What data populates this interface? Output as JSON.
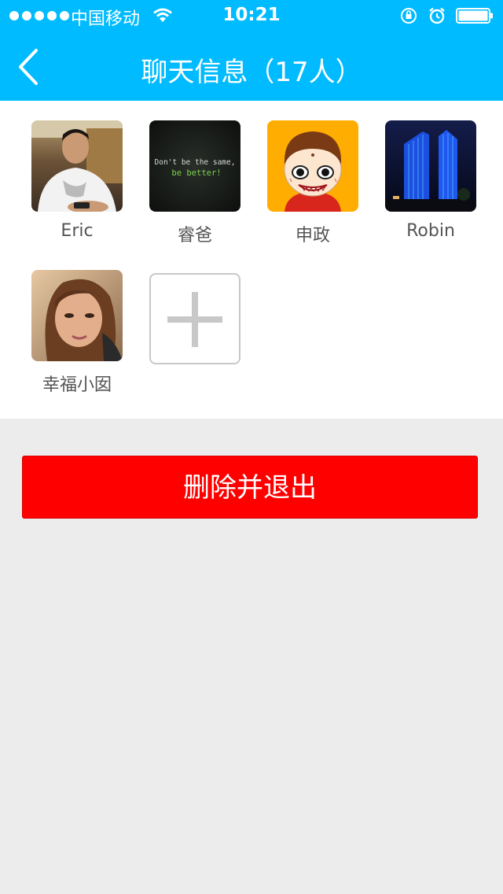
{
  "status_bar": {
    "carrier": "中国移动",
    "time": "10:21"
  },
  "nav": {
    "title": "聊天信息（17人）"
  },
  "members": [
    {
      "name": "Eric",
      "avatar": "photo-man"
    },
    {
      "name": "睿爸",
      "avatar": "text-dont-be-the-same"
    },
    {
      "name": "申政",
      "avatar": "cartoon-face"
    },
    {
      "name": "Robin",
      "avatar": "night-building"
    },
    {
      "name": "幸福小囡",
      "avatar": "photo-woman"
    }
  ],
  "avatar_text": {
    "line1": "Don't be the same,",
    "line2": "be better!"
  },
  "actions": {
    "delete_exit_label": "删除并退出"
  },
  "colors": {
    "header": "#00bbff",
    "delete_button": "#ff0000",
    "background": "#ececec"
  }
}
